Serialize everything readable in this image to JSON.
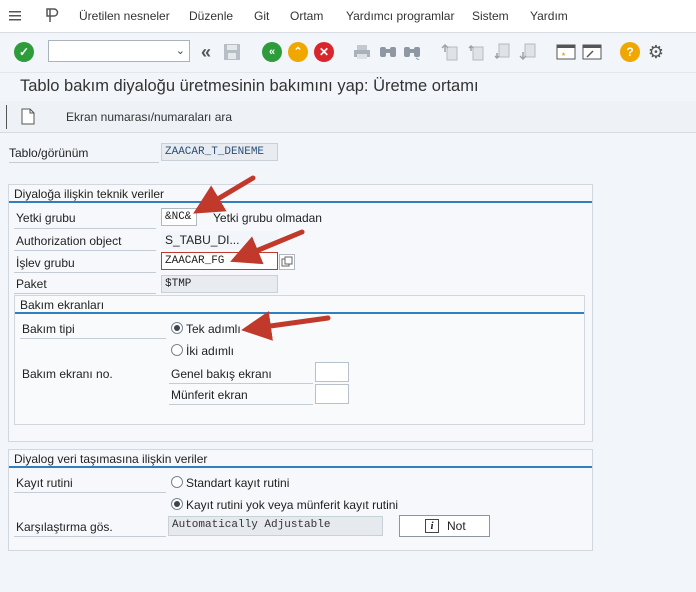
{
  "menu": {
    "items": [
      "Üretilen nesneler",
      "Düzenle",
      "Git",
      "Ortam",
      "Yardımcı programlar",
      "Sistem",
      "Yardım"
    ]
  },
  "toolbar": {
    "command_field": {
      "value": "",
      "placeholder": ""
    },
    "icons": [
      "check-icon",
      "back-icon",
      "save-icon",
      "green-back-icon",
      "exit-icon",
      "cancel-icon",
      "print-icon",
      "find-icon",
      "find-next-icon",
      "first-page-icon",
      "previous-page-icon",
      "next-page-icon",
      "last-page-icon",
      "new-session-icon",
      "shortcut-icon",
      "help-icon",
      "settings-icon"
    ],
    "colors": {
      "green": "#2e9c3b",
      "yellow": "#f0a800",
      "red": "#d9262c"
    }
  },
  "title": "Tablo bakım diyaloğu üretmesinin bakımını yap: Üretme ortamı",
  "app_toolbar": {
    "button_label": "Ekran numarası/numaraları ara"
  },
  "table_view": {
    "label": "Tablo/görünüm",
    "value": "ZAACAR_T_DENEME"
  },
  "tech_group": {
    "title": "Diyaloğa ilişkin teknik veriler",
    "auth_group_label": "Yetki grubu",
    "auth_group_value": "&NC&",
    "auth_group_text": "Yetki grubu olmadan",
    "auth_object_label": "Authorization object",
    "auth_object_value": "S_TABU_DI...",
    "function_group_label": "İşlev grubu",
    "function_group_value": "ZAACAR_FG",
    "package_label": "Paket",
    "package_value": "$TMP"
  },
  "screens_group": {
    "title": "Bakım ekranları",
    "maintenance_type_label": "Bakım tipi",
    "one_step": "Tek adımlı",
    "two_step": "İki adımlı",
    "screen_no_label": "Bakım ekranı no.",
    "overview_screen": "Genel bakış ekranı",
    "single_screen": "Münferit ekran",
    "selected": "one_step"
  },
  "transport_group": {
    "title": "Diyalog veri taşımasına ilişkin veriler",
    "recording_label": "Kayıt rutini",
    "standard": "Standart kayıt rutini",
    "none_or_individual": "Kayıt rutini yok veya münferit kayıt rutini",
    "compare_label": "Karşılaştırma gös.",
    "compare_value": "Automatically Adjustable",
    "note_button": "Not",
    "selected": "none_or_individual"
  },
  "annotation_color": "#c0392b"
}
